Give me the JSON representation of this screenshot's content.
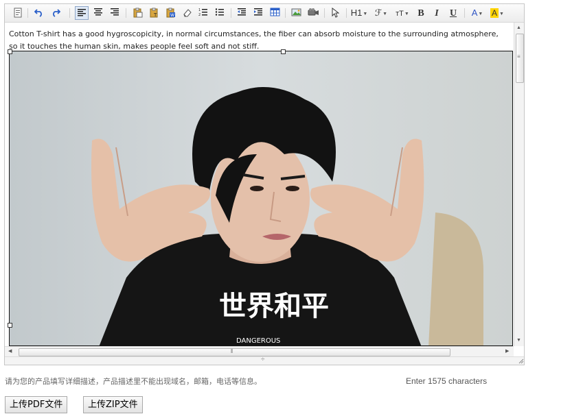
{
  "toolbar": {
    "heading_label": "H1",
    "font_family_glyph": "ℱ",
    "font_size_glyph": "тT",
    "bold_label": "B",
    "italic_label": "I",
    "underline_label": "U",
    "font_color_glyph": "A",
    "highlight_glyph": "A",
    "font_color": "#2f55c4",
    "highlight_color": "#ffd400"
  },
  "editor": {
    "paragraph": "Cotton T-shirt has a good hygroscopicity, in normal circumstances, the fiber can absorb moisture to the surrounding atmosphere, so it touches the human skin, makes people feel soft and not stiff.",
    "image_shirt_text": "世界和平",
    "image_shirt_subtext": "DANGEROUS"
  },
  "footer": {
    "hint": "请为您的产品填写详细描述，产品描述里不能出现域名，邮箱，电话等信息。",
    "char_count": "Enter 1575 characters",
    "upload_pdf": "上传PDF文件",
    "upload_zip": "上传ZIP文件"
  }
}
